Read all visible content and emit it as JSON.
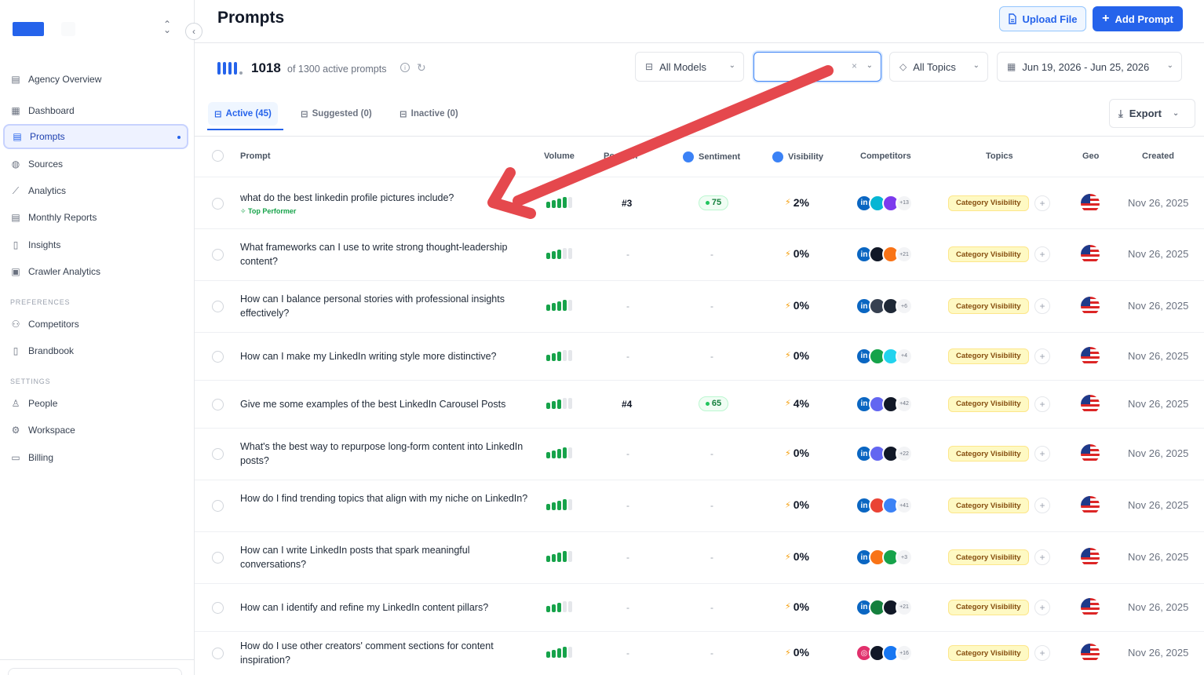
{
  "sidebar": {
    "items": [
      {
        "label": "Agency Overview",
        "icon": "globe-icon"
      },
      {
        "label": "Dashboard",
        "icon": "grid-icon"
      },
      {
        "label": "Prompts",
        "icon": "document-icon"
      },
      {
        "label": "Sources",
        "icon": "globe-icon"
      },
      {
        "label": "Analytics",
        "icon": "chart-icon"
      },
      {
        "label": "Monthly Reports",
        "icon": "report-icon"
      },
      {
        "label": "Insights",
        "icon": "lightbulb-icon"
      },
      {
        "label": "Crawler Analytics",
        "icon": "terminal-icon"
      }
    ],
    "preferences_label": "PREFERENCES",
    "preferences": [
      {
        "label": "Competitors",
        "icon": "users-icon"
      },
      {
        "label": "Brandbook",
        "icon": "book-icon"
      }
    ],
    "settings_label": "SETTINGS",
    "settings": [
      {
        "label": "People",
        "icon": "user-icon"
      },
      {
        "label": "Workspace",
        "icon": "gear-icon"
      },
      {
        "label": "Billing",
        "icon": "card-icon"
      }
    ]
  },
  "header": {
    "title": "Prompts",
    "upload_label": "Upload File",
    "add_label": "Add Prompt"
  },
  "summary": {
    "count": "1018",
    "sub": "of 1300 active prompts"
  },
  "filters": {
    "models": "All Models",
    "search_value": "",
    "topics": "All Topics",
    "date_range": "Jun 19, 2026 - Jun 25, 2026"
  },
  "tabs": [
    {
      "label": "Active (45)"
    },
    {
      "label": "Suggested (0)"
    },
    {
      "label": "Inactive (0)"
    }
  ],
  "export_label": "Export",
  "columns": {
    "prompt": "Prompt",
    "volume": "Volume",
    "position": "Position",
    "sentiment": "Sentiment",
    "visibility": "Visibility",
    "competitors": "Competitors",
    "topics": "Topics",
    "geo": "Geo",
    "created": "Created"
  },
  "top_performer_label": "Top Performer",
  "rows": [
    {
      "prompt": "what do the best linkedin profile pictures include?",
      "top": true,
      "volume": 4,
      "position": "#3",
      "sentiment": "75",
      "visibility": "2%",
      "more": "+13",
      "topic": "Category Visibility",
      "created": "Nov 26, 2025"
    },
    {
      "prompt": "What frameworks can I use to write strong thought-leadership content?",
      "volume": 3,
      "position": "-",
      "sentiment": "-",
      "visibility": "0%",
      "more": "+21",
      "topic": "Category Visibility",
      "created": "Nov 26, 2025"
    },
    {
      "prompt": "How can I balance personal stories with professional insights effectively?",
      "volume": 4,
      "position": "-",
      "sentiment": "-",
      "visibility": "0%",
      "more": "+6",
      "topic": "Category Visibility",
      "created": "Nov 26, 2025"
    },
    {
      "prompt": "How can I make my LinkedIn writing style more distinctive?",
      "volume": 3,
      "position": "-",
      "sentiment": "-",
      "visibility": "0%",
      "more": "+4",
      "topic": "Category Visibility",
      "created": "Nov 26, 2025"
    },
    {
      "prompt": "Give me some examples of the best LinkedIn Carousel Posts",
      "volume": 3,
      "position": "#4",
      "sentiment": "65",
      "visibility": "4%",
      "more": "+42",
      "topic": "Category Visibility",
      "created": "Nov 26, 2025"
    },
    {
      "prompt": "What's the best way to repurpose long-form content into LinkedIn posts?",
      "volume": 4,
      "position": "-",
      "sentiment": "-",
      "visibility": "0%",
      "more": "+22",
      "topic": "Category Visibility",
      "created": "Nov 26, 2025"
    },
    {
      "prompt": "How do I find trending topics that align with my niche on LinkedIn?",
      "volume": 4,
      "position": "-",
      "sentiment": "-",
      "visibility": "0%",
      "more": "+41",
      "topic": "Category Visibility",
      "created": "Nov 26, 2025"
    },
    {
      "prompt": "How can I write LinkedIn posts that spark meaningful conversations?",
      "volume": 4,
      "position": "-",
      "sentiment": "-",
      "visibility": "0%",
      "more": "+3",
      "topic": "Category Visibility",
      "created": "Nov 26, 2025"
    },
    {
      "prompt": "How can I identify and refine my LinkedIn content pillars?",
      "volume": 3,
      "position": "-",
      "sentiment": "-",
      "visibility": "0%",
      "more": "+21",
      "topic": "Category Visibility",
      "created": "Nov 26, 2025"
    },
    {
      "prompt": "How do I use other creators' comment sections for content inspiration?",
      "volume": 4,
      "position": "-",
      "sentiment": "-",
      "visibility": "0%",
      "more": "+16",
      "topic": "Category Visibility",
      "created": "Nov 26, 2025"
    }
  ],
  "colors": {
    "accent": "#2563eb",
    "annotation_arrow": "#e5484d",
    "volume_green": "#16a34a",
    "topic_bg": "#fef9c3"
  }
}
